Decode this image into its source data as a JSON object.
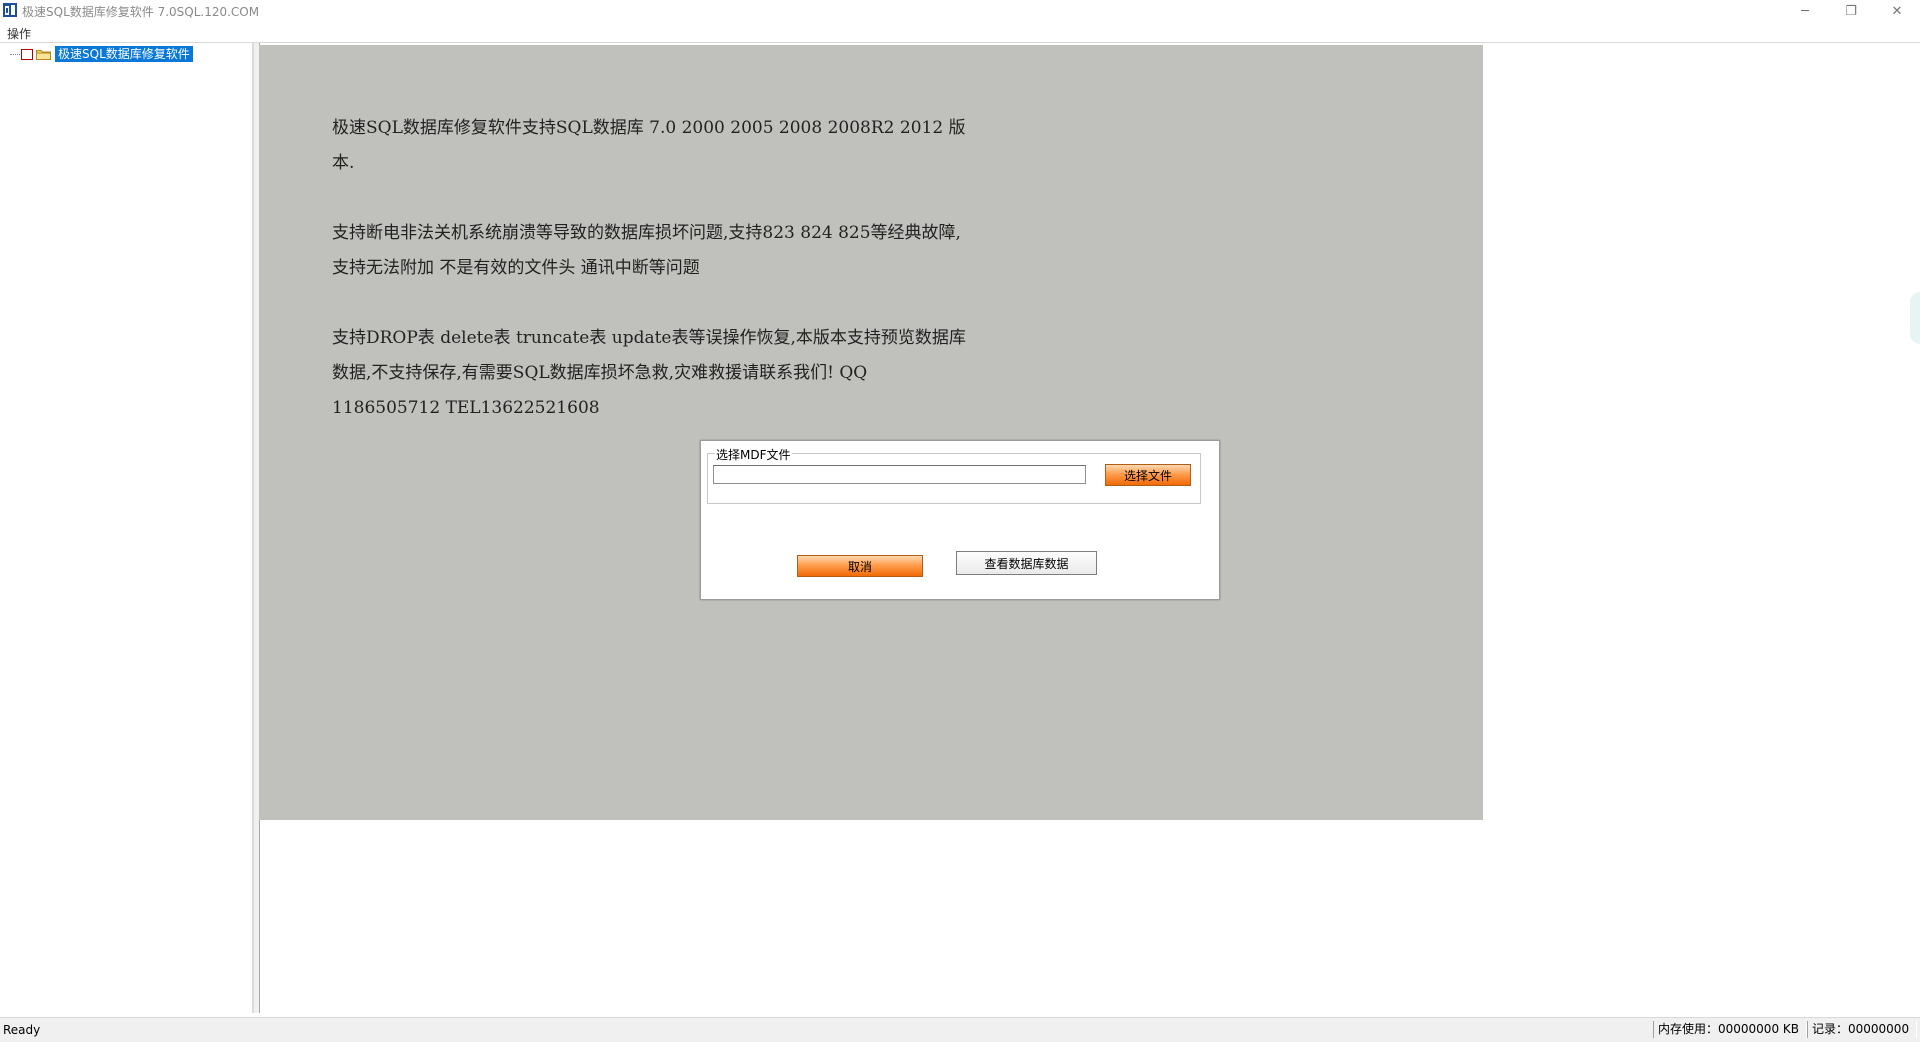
{
  "window": {
    "title": "极速SQL数据库修复软件 7.0SQL.120.COM",
    "minimize_glyph": "─",
    "restore_glyph": "❐",
    "close_glyph": "✕"
  },
  "menu": {
    "items": [
      {
        "label": "操作"
      }
    ]
  },
  "tree": {
    "root_label": "极速SQL数据库修复软件"
  },
  "info": {
    "paragraphs": [
      "极速SQL数据库修复软件支持SQL数据库 7.0 2000 2005 2008 2008R2 2012 版本.",
      "支持断电非法关机系统崩溃等导致的数据库损坏问题,支持823 824 825等经典故障,支持无法附加 不是有效的文件头 通讯中断等问题",
      "支持DROP表 delete表 truncate表 update表等误操作恢复,本版本支持预览数据库数据,不支持保存,有需要SQL数据库损坏急救,灾难救援请联系我们! QQ 1186505712 TEL13622521608"
    ]
  },
  "dialog": {
    "group_label": "选择MDF文件",
    "file_path_value": "",
    "choose_file_label": "选择文件",
    "cancel_label": "取消",
    "view_data_label": "查看数据库数据"
  },
  "statusbar": {
    "ready": "Ready",
    "memory": "内存使用：00000000 KB",
    "records": "记录：00000000"
  },
  "colors": {
    "selection": "#0a78d7",
    "panel_gray": "#c0c0bc",
    "button_orange": "#f06a06"
  }
}
